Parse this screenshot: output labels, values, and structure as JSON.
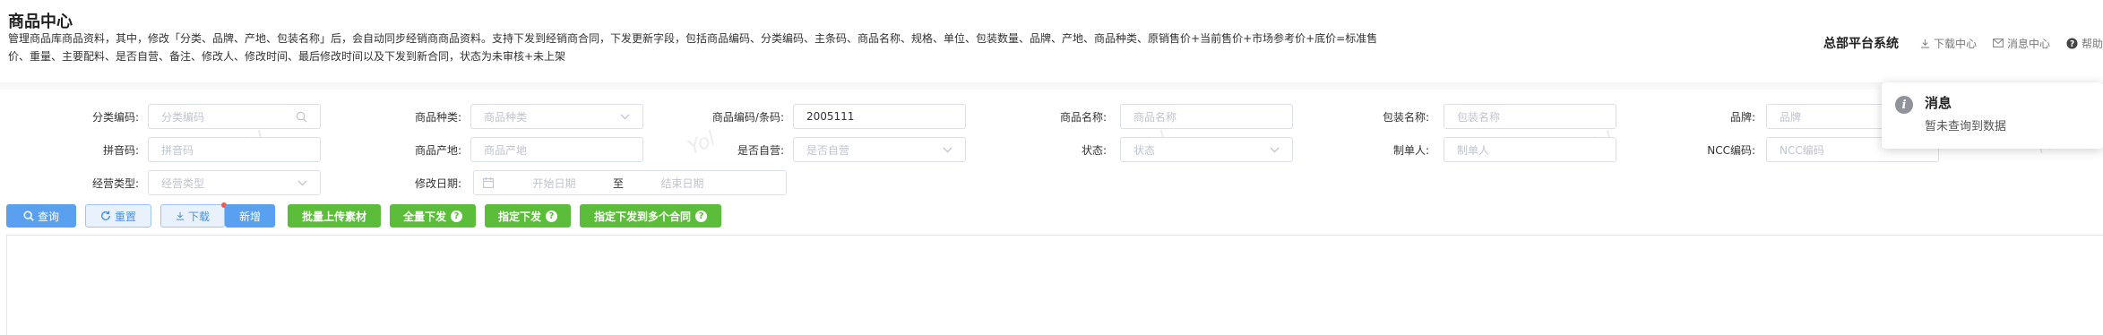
{
  "header": {
    "title": "商品中心",
    "description": "管理商品库商品资料，其中，修改「分类、品牌、产地、包装名称」后，会自动同步经销商商品资料。支持下发到经销商合同，下发更新字段，包括商品编码、分类编码、主条码、商品名称、规格、单位、包装数量、品牌、产地、商品种类、原销售价+当前售价+市场参考价+底价=标准售价、重量、主要配料、是否自营、备注、修改人、修改时间、最后修改时间以及下发到新合同，状态为未审核+未上架",
    "system_name": "总部平台系统",
    "links": {
      "download_center": "下载中心",
      "message_center": "消息中心",
      "help": "帮助"
    }
  },
  "form": {
    "category_code": {
      "label": "分类编码:",
      "placeholder": "分类编码"
    },
    "product_type": {
      "label": "商品种类:",
      "placeholder": "商品种类"
    },
    "product_code": {
      "label": "商品编码/条码:",
      "value": "2005111"
    },
    "product_name": {
      "label": "商品名称:",
      "placeholder": "商品名称"
    },
    "package_name": {
      "label": "包装名称:",
      "placeholder": "包装名称"
    },
    "brand": {
      "label": "品牌:",
      "placeholder": "品牌"
    },
    "pinyin": {
      "label": "拼音码:",
      "placeholder": "拼音码"
    },
    "origin": {
      "label": "商品产地:",
      "placeholder": "商品产地"
    },
    "self_operated": {
      "label": "是否自营:",
      "placeholder": "是否自营"
    },
    "status": {
      "label": "状态:",
      "placeholder": "状态"
    },
    "creator": {
      "label": "制单人:",
      "placeholder": "制单人"
    },
    "ncc_code": {
      "label": "NCC编码:",
      "placeholder": "NCC编码"
    },
    "business_type": {
      "label": "经营类型:",
      "placeholder": "经营类型"
    },
    "modify_date": {
      "label": "修改日期:",
      "start_placeholder": "开始日期",
      "separator": "至",
      "end_placeholder": "结束日期"
    }
  },
  "buttons": {
    "query": "查询",
    "reset": "重置",
    "download": "下载",
    "add": "新增",
    "batch_upload": "批量上传素材",
    "issue_all": "全量下发",
    "issue_specified": "指定下发",
    "issue_multi_contract": "指定下发到多个合同"
  },
  "toast": {
    "title": "消息",
    "body": "暂未查询到数据"
  },
  "watermark": "Yol",
  "colors": {
    "primary": "#5aa0f0",
    "success": "#5bbd3a"
  }
}
